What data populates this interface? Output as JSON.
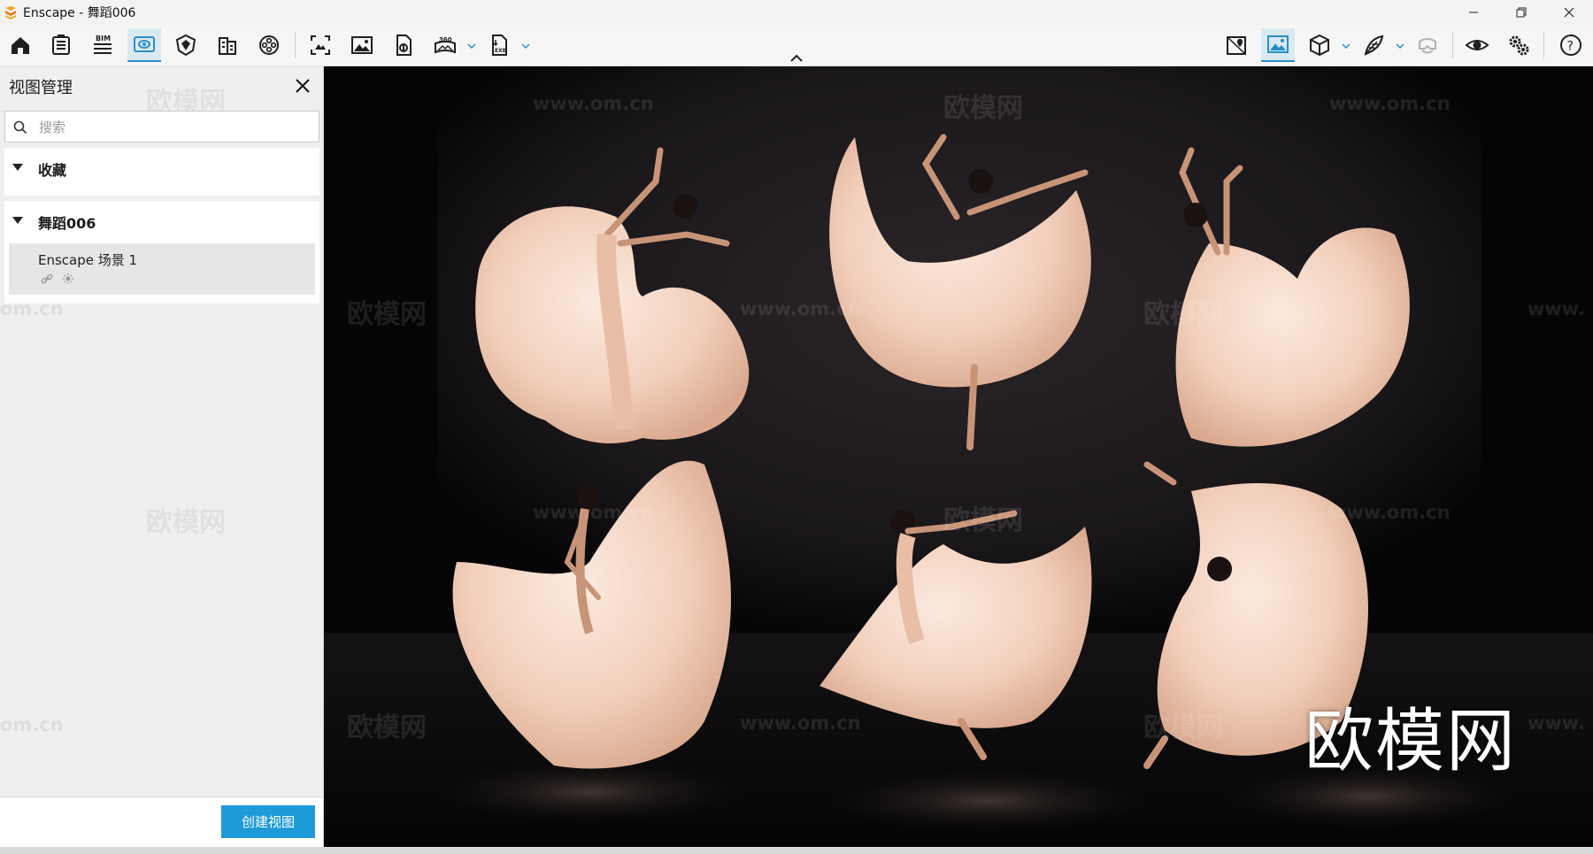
{
  "window": {
    "title": "Enscape - 舞蹈006",
    "controls": [
      "minimize",
      "restore",
      "close"
    ]
  },
  "toolbar": {
    "left_tools": [
      {
        "name": "home-icon"
      },
      {
        "name": "clipboard-icon"
      },
      {
        "name": "bim-icon",
        "label": "BIM"
      },
      {
        "name": "view-management-icon",
        "active": true
      },
      {
        "name": "asset-library-icon"
      },
      {
        "name": "building-icon"
      },
      {
        "name": "video-reel-icon"
      },
      {
        "name": "screenshot-icon"
      },
      {
        "name": "batch-render-icon"
      },
      {
        "name": "upload-icon"
      },
      {
        "name": "panorama-360-icon",
        "label": "360"
      },
      {
        "name": "export-exe-icon",
        "label": "EXE"
      }
    ],
    "right_tools": [
      {
        "name": "map-pin-icon"
      },
      {
        "name": "visual-settings-icon"
      },
      {
        "name": "cube-icon"
      },
      {
        "name": "feather-icon"
      },
      {
        "name": "vr-headset-icon"
      },
      {
        "name": "eye-icon"
      },
      {
        "name": "gears-icon"
      },
      {
        "name": "help-icon",
        "label": "?"
      }
    ]
  },
  "panel": {
    "title": "视图管理",
    "search_placeholder": "搜索",
    "groups": [
      {
        "label": "收藏",
        "items": []
      },
      {
        "label": "舞蹈006",
        "items": [
          {
            "name": "Enscape 场景 1"
          }
        ]
      }
    ],
    "create_button": "创建视图"
  },
  "viewport": {
    "brand_overlay": "欧模网",
    "watermark_text": "欧模网",
    "watermark_url": "www.om.cn",
    "watermark_url_partial_1": "om.cn",
    "watermark_url_partial_2": "www.om.cn",
    "watermark_url_partial_3": "www.",
    "dress_color": "#f3d6c4",
    "background_color": "#1e1b1f"
  },
  "colors": {
    "accent": "#1d9ad8",
    "active_tab": "#dbe9f3"
  }
}
